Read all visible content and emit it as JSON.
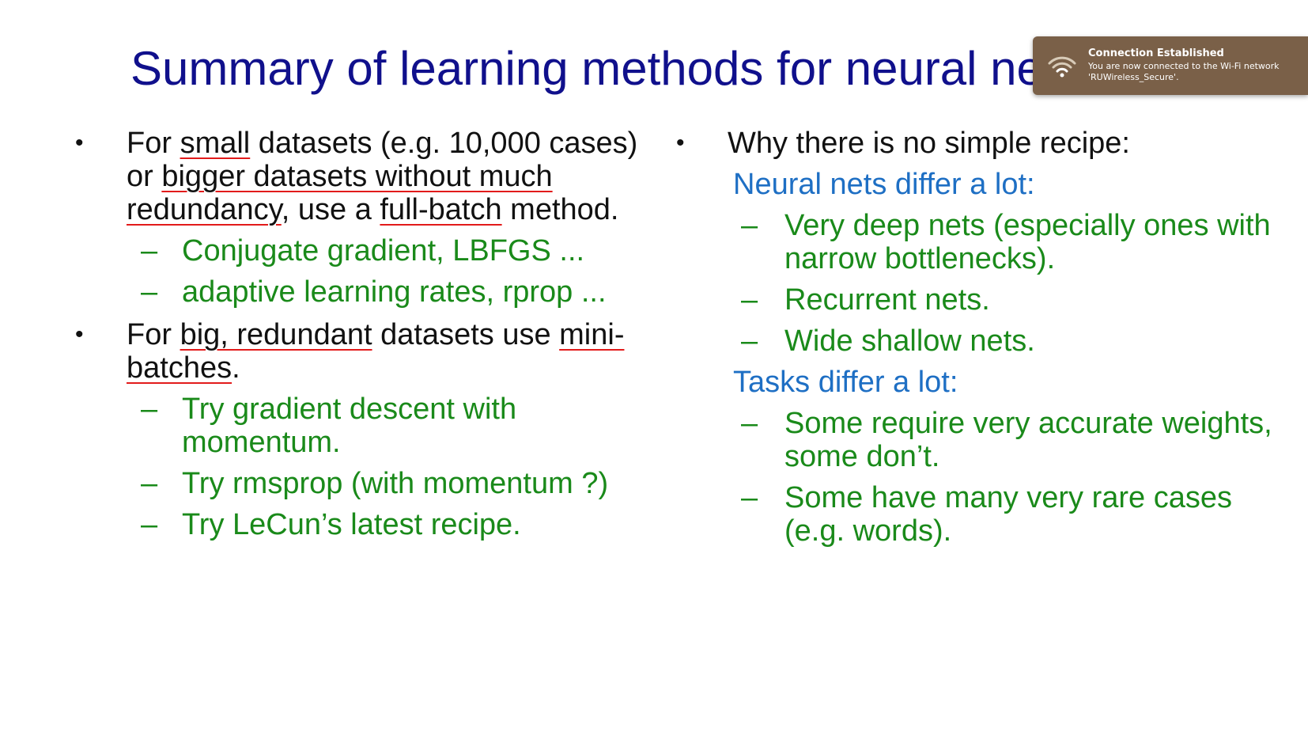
{
  "slide": {
    "title": "Summary of learning methods for neural networks"
  },
  "left": {
    "b1": {
      "pre1": "For ",
      "u1": "small",
      "mid1": " datasets (e.g. 10,000 cases) or ",
      "u2": "bigger datasets without much redundancy",
      "mid2": ", use a ",
      "u3": "full-batch",
      "post": " method."
    },
    "b1_subs": [
      "Conjugate gradient, LBFGS ...",
      "adaptive learning rates, rprop ..."
    ],
    "b2": {
      "pre": "For ",
      "u1": "big, redundant",
      "mid": " datasets use ",
      "u2": "mini-batches",
      "post": "."
    },
    "b2_subs": [
      "Try gradient descent with momentum.",
      "Try rmsprop (with momentum ?)",
      "Try LeCun’s latest recipe."
    ]
  },
  "right": {
    "b1": "Why there is no simple recipe:",
    "h1": "Neural nets differ a lot:",
    "h1_subs": [
      "Very deep nets (especially ones with narrow bottlenecks).",
      "Recurrent nets.",
      "Wide shallow nets."
    ],
    "h2": "Tasks differ a lot:",
    "h2_subs": [
      "Some require very accurate weights, some don’t.",
      "Some have many very rare cases (e.g. words)."
    ]
  },
  "markers": {
    "bullet": "•",
    "dash": "–"
  },
  "notification": {
    "icon": "wifi-icon",
    "title": "Connection Established",
    "body": "You are now connected to the Wi-Fi network 'RUWireless_Secure'."
  },
  "colors": {
    "title": "#10108c",
    "sub_text": "#1a8a1a",
    "heading": "#1e6fc4",
    "underline": "#e21b1b",
    "toast_bg": "#7a6048"
  }
}
